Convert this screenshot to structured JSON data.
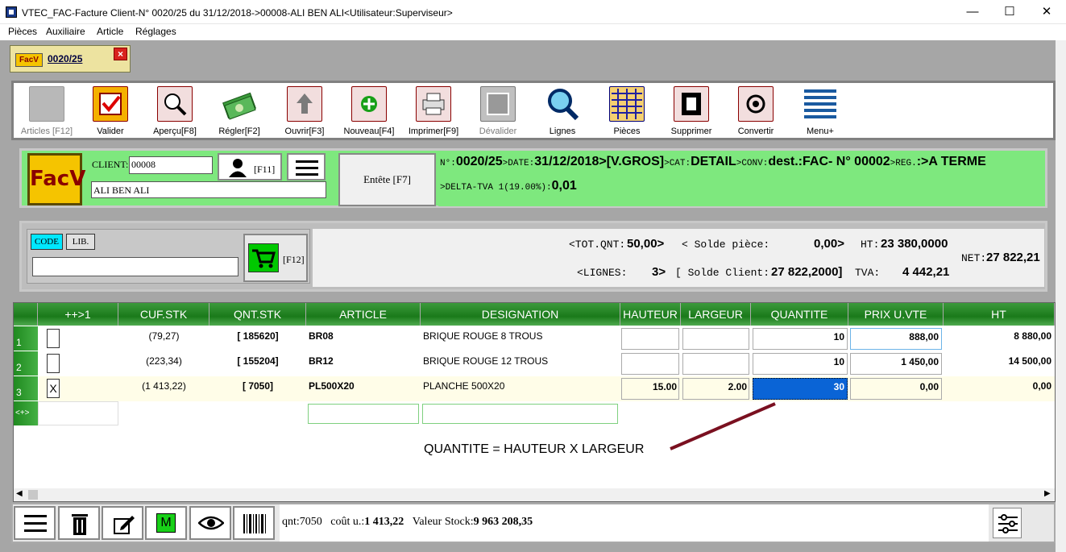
{
  "window": {
    "title": "VTEC_FAC-Facture Client-N° 0020/25 du 31/12/2018->00008-ALI BEN ALI<Utilisateur:Superviseur>",
    "minimize": "—",
    "maximize": "☐",
    "close": "✕"
  },
  "menu": [
    "Pièces",
    "Auxiliaire",
    "Article",
    "Réglages"
  ],
  "doc_tab": {
    "icon_text": "FacV",
    "label": "0020/25",
    "close": "×"
  },
  "toolbar": [
    {
      "label": "Articles [F12]",
      "icon": "articles-icon",
      "disabled": true
    },
    {
      "label": "Valider",
      "icon": "validate-check-icon",
      "disabled": false
    },
    {
      "label": "Aperçu[F8]",
      "icon": "preview-magnifier-icon",
      "disabled": false
    },
    {
      "label": "Régler[F2]",
      "icon": "money-stack-icon",
      "disabled": false
    },
    {
      "label": "Ouvrir[F3]",
      "icon": "up-arrow-icon",
      "disabled": false
    },
    {
      "label": "Nouveau[F4]",
      "icon": "add-plus-icon",
      "disabled": false
    },
    {
      "label": "Imprimer[F9]",
      "icon": "printer-icon",
      "disabled": false
    },
    {
      "label": "Dévalider",
      "icon": "unvalidate-icon",
      "disabled": true
    },
    {
      "label": "Lignes",
      "icon": "search-lines-icon",
      "disabled": false
    },
    {
      "label": "Pièces",
      "icon": "grid-pieces-icon",
      "disabled": false
    },
    {
      "label": "Supprimer",
      "icon": "trash-icon",
      "disabled": false
    },
    {
      "label": "Convertir",
      "icon": "convert-gear-icon",
      "disabled": false
    },
    {
      "label": "Menu+",
      "icon": "menu-lines-icon",
      "disabled": false
    }
  ],
  "header": {
    "logo_text": "FacV",
    "client_label": "CLIENT:",
    "client_code": "00008",
    "client_name": "ALI BEN ALI",
    "user_btn_label": "[F11]",
    "entete_label": "Entête [F7]",
    "info": {
      "n_lbl": "N°:",
      "n_val": "0020/25",
      "date_lbl": ">DATE:",
      "date_val": "31/12/2018",
      "vgros": ">[V.GROS]",
      "cat_lbl": ">CAT:",
      "cat_val": "DETAIL",
      "conv_lbl": ">CONV:",
      "conv_val": "dest.:FAC- N° 00002",
      "reg_lbl": ">REG.",
      "reg_val": ":>A TERME",
      "delta_lbl": ">DELTA-TVA 1(19.00%):",
      "delta_val": "0,01"
    }
  },
  "search": {
    "code_tab": "CODE",
    "lib_tab": "LIB.",
    "cart_label": "[F12]"
  },
  "totals": {
    "tot_qnt_lbl": "<TOT.QNT:",
    "tot_qnt_val": "50,00>",
    "solde_piece_lbl": "< Solde pièce:",
    "solde_piece_val": "0,00>",
    "ht_lbl": "HT:",
    "ht_val": "23 380,0000",
    "net_lbl": "NET:",
    "net_val": "27 822,21",
    "lignes_lbl": "<LIGNES:",
    "lignes_val": "3>",
    "solde_client_lbl": "[ Solde Client:",
    "solde_client_val": "27 822,2000]",
    "tva_lbl": "TVA:",
    "tva_val": "4 442,21"
  },
  "grid": {
    "columns": [
      "++>1",
      "CUF.STK",
      "QNT.STK",
      "ARTICLE",
      "DESIGNATION",
      "HAUTEUR",
      "LARGEUR",
      "QUANTITE",
      "PRIX U.VTE",
      "HT"
    ],
    "rows": [
      {
        "num": "1",
        "check": "",
        "cuf": "(79,27)",
        "qnt": "[ 185620]",
        "article": "BR08",
        "designation": "BRIQUE ROUGE 8 TROUS",
        "hauteur": "",
        "largeur": "",
        "quantite": "10",
        "prix": "888,00",
        "ht": "8 880,00"
      },
      {
        "num": "2",
        "check": "",
        "cuf": "(223,34)",
        "qnt": "[ 155204]",
        "article": "BR12",
        "designation": "BRIQUE ROUGE 12 TROUS",
        "hauteur": "",
        "largeur": "",
        "quantite": "10",
        "prix": "1 450,00",
        "ht": "14 500,00"
      },
      {
        "num": "3",
        "check": "X",
        "cuf": "(1 413,22)",
        "qnt": "[ 7050]",
        "article": "PL500X20",
        "designation": "PLANCHE 500X20",
        "hauteur": "15.00",
        "largeur": "2.00",
        "quantite": "30",
        "prix": "0,00",
        "ht": "0,00"
      }
    ],
    "new_row_marker": "<+>"
  },
  "annotation": "QUANTITE = HAUTEUR X LARGEUR",
  "bottom": {
    "qnt": "qnt:7050",
    "cout_lbl": "coût u.:",
    "cout_val": "1 413,22",
    "valeur_lbl": "Valeur Stock:",
    "valeur_val": "9 963 208,35"
  },
  "colors": {
    "green_panel": "#7ee87e",
    "grid_header": "#1a7a1a",
    "selection_blue": "#0a64d6"
  }
}
